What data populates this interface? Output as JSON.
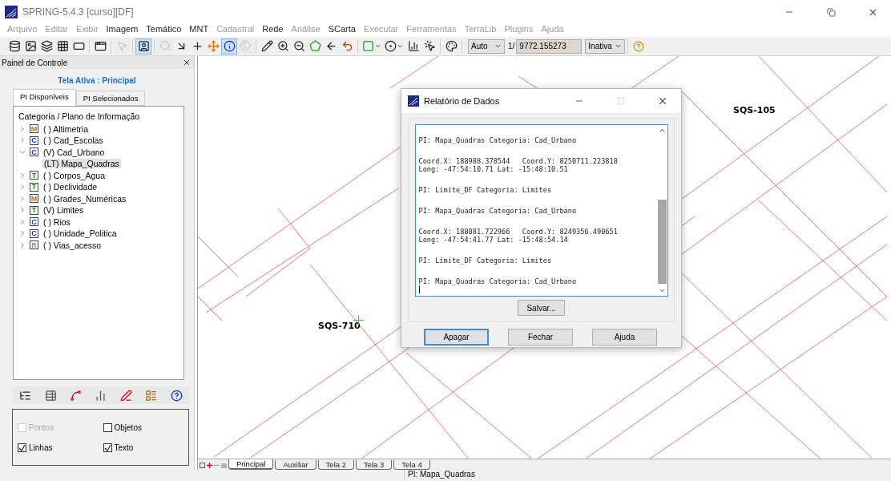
{
  "window": {
    "title": "SPRING-5.4.3 [curso][DF]"
  },
  "menu": [
    {
      "label": "Arquivo",
      "disabled": true
    },
    {
      "label": "Editar",
      "disabled": true
    },
    {
      "label": "Exibir",
      "disabled": true
    },
    {
      "label": "Imagem",
      "disabled": false
    },
    {
      "label": "Temático",
      "disabled": false
    },
    {
      "label": "MNT",
      "disabled": false
    },
    {
      "label": "Cadastral",
      "disabled": true
    },
    {
      "label": "Rede",
      "disabled": false
    },
    {
      "label": "Análise",
      "disabled": true
    },
    {
      "label": "SCarta",
      "disabled": false
    },
    {
      "label": "Executar",
      "disabled": true
    },
    {
      "label": "Ferramentas",
      "disabled": true
    },
    {
      "label": "TerraLib",
      "disabled": true
    },
    {
      "label": "Plugins",
      "disabled": true
    },
    {
      "label": "Ajuda",
      "disabled": true
    }
  ],
  "toolbar": {
    "tools": [
      {
        "kind": "database",
        "pressed": false,
        "disabled": false
      },
      {
        "kind": "image",
        "pressed": false,
        "disabled": false
      },
      {
        "kind": "layers",
        "pressed": false,
        "disabled": false
      },
      {
        "kind": "grid",
        "pressed": false,
        "disabled": false
      },
      {
        "kind": "parallelogram",
        "pressed": false,
        "disabled": false
      },
      {
        "kind": "separator"
      },
      {
        "kind": "window",
        "pressed": false,
        "disabled": false
      },
      {
        "kind": "separator"
      },
      {
        "kind": "cursor",
        "pressed": false,
        "disabled": true
      },
      {
        "kind": "separator"
      },
      {
        "kind": "person",
        "pressed": true,
        "disabled": false
      },
      {
        "kind": "separator"
      },
      {
        "kind": "search",
        "pressed": false,
        "disabled": true
      },
      {
        "kind": "corner-arrow",
        "pressed": false,
        "disabled": false
      },
      {
        "kind": "plus",
        "pressed": false,
        "disabled": false
      },
      {
        "kind": "move",
        "pressed": false,
        "disabled": false
      },
      {
        "kind": "info",
        "pressed": true,
        "disabled": false
      },
      {
        "kind": "tags",
        "pressed": false,
        "disabled": true
      },
      {
        "kind": "separator"
      },
      {
        "kind": "pencil",
        "pressed": false,
        "disabled": false
      },
      {
        "kind": "zoom-in",
        "pressed": false,
        "disabled": false
      },
      {
        "kind": "zoom-out",
        "pressed": false,
        "disabled": false
      },
      {
        "kind": "polygon",
        "pressed": false,
        "disabled": false
      },
      {
        "kind": "arrow-left",
        "pressed": false,
        "disabled": false
      },
      {
        "kind": "undo",
        "pressed": false,
        "disabled": false
      },
      {
        "kind": "separator"
      },
      {
        "kind": "fill-menu",
        "pressed": false,
        "disabled": false
      },
      {
        "kind": "symbol-menu",
        "pressed": false,
        "disabled": false
      },
      {
        "kind": "chart",
        "pressed": false,
        "disabled": false
      },
      {
        "kind": "cursor-plus",
        "pressed": false,
        "disabled": false
      },
      {
        "kind": "separator"
      },
      {
        "kind": "palette",
        "pressed": false,
        "disabled": false
      },
      {
        "kind": "separator"
      }
    ],
    "mode": "Auto",
    "scale_prefix": "1/",
    "scale": "9772.155273",
    "state": "Inativa"
  },
  "panel": {
    "title": "Painel de Controle",
    "active_screen": "Tela Ativa : Principal",
    "tabs": [
      {
        "label": "PI Disponíveis",
        "selected": true
      },
      {
        "label": "PI Selecionados",
        "selected": false
      }
    ],
    "tree_header": "Categoria / Plano de Informação",
    "tree": [
      {
        "badge": "M",
        "color": "#b07800",
        "label": "( ) Altimetria",
        "expanded": false
      },
      {
        "badge": "C",
        "color": "#1030e0",
        "label": "( ) Cad_Escolas",
        "expanded": false
      },
      {
        "badge": "C",
        "color": "#1030e0",
        "label": "(V) Cad_Urbano",
        "expanded": true,
        "children": [
          {
            "label": "(LT) Mapa_Quadras",
            "selected": true
          }
        ]
      },
      {
        "badge": "T",
        "color": "#108010",
        "label": "( ) Corpos_Agua",
        "expanded": false
      },
      {
        "badge": "T",
        "color": "#108010",
        "label": "( ) Declividade",
        "expanded": false
      },
      {
        "badge": "M",
        "color": "#b07800",
        "label": "( ) Grades_Numéricas",
        "expanded": false
      },
      {
        "badge": "T",
        "color": "#108010",
        "label": "(V) Limites",
        "expanded": false
      },
      {
        "badge": "C",
        "color": "#1030e0",
        "label": "( ) Rios",
        "expanded": false
      },
      {
        "badge": "C",
        "color": "#1030e0",
        "label": "( ) Unidade_Politica",
        "expanded": false
      },
      {
        "badge": "R",
        "color": "#909090",
        "label": "( ) Vias_acesso",
        "expanded": false
      }
    ],
    "tools": [
      {
        "kind": "list"
      },
      {
        "kind": "table-zoom"
      },
      {
        "kind": "edit-points"
      },
      {
        "kind": "bars"
      },
      {
        "kind": "pen"
      },
      {
        "kind": "legend"
      },
      {
        "kind": "help"
      }
    ],
    "options": [
      {
        "label": "Pontos",
        "checked": false,
        "disabled": true
      },
      {
        "label": "Objetos",
        "checked": false,
        "disabled": false
      },
      {
        "label": "Linhas",
        "checked": true,
        "disabled": false
      },
      {
        "label": "Texto",
        "checked": true,
        "disabled": false
      }
    ]
  },
  "map": {
    "labels": [
      "SQS-105",
      "SQS-710"
    ]
  },
  "dialog": {
    "title": "Relatório de Dados",
    "report": [
      [
        "PI: Mapa_Quadras Categoria: Cad_Urbano"
      ],
      [
        "Coord.X: 188988.378544   Coord.Y: 8250711.223818",
        "Long: -47:54:10.71 Lat: -15:48:10.51"
      ],
      [
        "PI: Limite_DF Categoria: Limites"
      ],
      [
        "PI: Mapa_Quadras Categoria: Cad_Urbano"
      ],
      [
        "Coord.X: 188081.722966   Coord.Y: 8249356.490651",
        "Long: -47:54:41.77 Lat: -15:48:54.14"
      ],
      [
        "PI: Limite_DF Categoria: Limites"
      ],
      [
        "PI: Mapa_Quadras Categoria: Cad_Urbano"
      ]
    ],
    "save": "Salvar...",
    "buttons": [
      {
        "label": "Apagar",
        "default": true
      },
      {
        "label": "Fechar",
        "default": false
      },
      {
        "label": "Ajuda",
        "default": false
      }
    ]
  },
  "screen_tabs": [
    {
      "label": "Principal",
      "selected": true
    },
    {
      "label": "Auxiliar",
      "selected": false
    },
    {
      "label": "Tela 2",
      "selected": false
    },
    {
      "label": "Tela 3",
      "selected": false
    },
    {
      "label": "Tela 4",
      "selected": false
    }
  ],
  "status_bar": "PI: Mapa_Quadras"
}
